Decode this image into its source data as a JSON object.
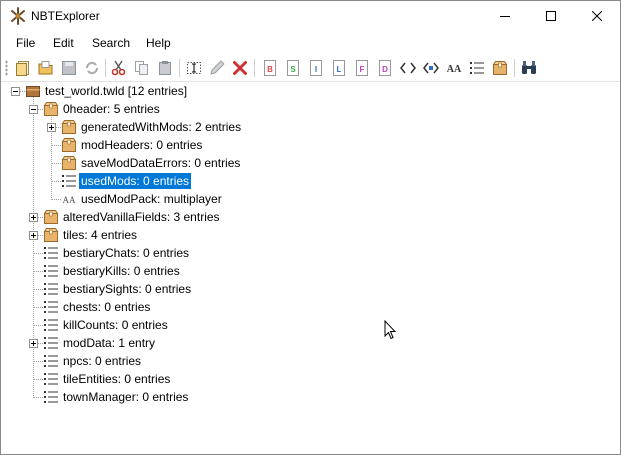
{
  "window": {
    "title": "NBTExplorer"
  },
  "menu": {
    "items": [
      "File",
      "Edit",
      "Search",
      "Help"
    ]
  },
  "toolbar": {
    "tag_letters": {
      "byte": "B",
      "short": "S",
      "int": "I",
      "long": "L",
      "float": "F",
      "double": "D"
    },
    "string_glyph": "AA"
  },
  "tree": {
    "root": "test_world.twld [12 entries]",
    "nodes": [
      {
        "label": "0header: 5 entries",
        "type": "compound",
        "expanded": true
      },
      {
        "label": "generatedWithMods: 2 entries",
        "type": "compound",
        "expanded": false
      },
      {
        "label": "modHeaders: 0 entries",
        "type": "compound"
      },
      {
        "label": "saveModDataErrors: 0 entries",
        "type": "compound"
      },
      {
        "label": "usedMods: 0 entries",
        "type": "list",
        "selected": true
      },
      {
        "label": "usedModPack: multiplayer",
        "type": "string"
      },
      {
        "label": "alteredVanillaFields: 3 entries",
        "type": "compound",
        "expanded": false
      },
      {
        "label": "tiles: 4 entries",
        "type": "compound",
        "expanded": false
      },
      {
        "label": "bestiaryChats: 0 entries",
        "type": "list"
      },
      {
        "label": "bestiaryKills: 0 entries",
        "type": "list"
      },
      {
        "label": "bestiarySights: 0 entries",
        "type": "list"
      },
      {
        "label": "chests: 0 entries",
        "type": "list"
      },
      {
        "label": "killCounts: 0 entries",
        "type": "list"
      },
      {
        "label": "modData: 1 entry",
        "type": "list",
        "expanded": false
      },
      {
        "label": "npcs: 0 entries",
        "type": "list"
      },
      {
        "label": "tileEntities: 0 entries",
        "type": "list"
      },
      {
        "label": "townManager: 0 entries",
        "type": "list"
      }
    ]
  },
  "colors": {
    "selection": "#0078d7",
    "compound": "#d9a35b",
    "list_icon": "#333333",
    "close_red": "#d03030"
  }
}
